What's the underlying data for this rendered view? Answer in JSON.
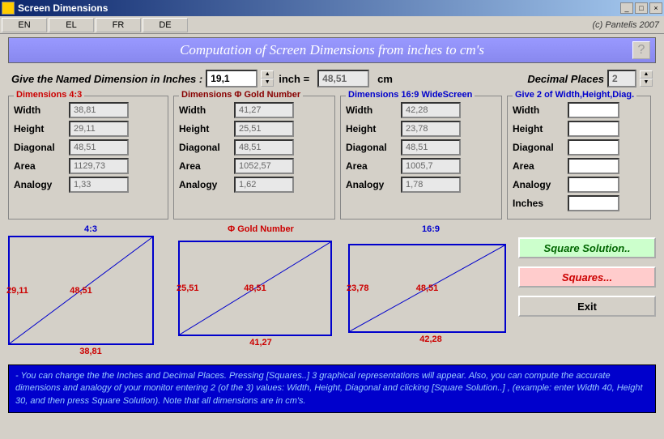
{
  "window": {
    "title": "Screen Dimensions"
  },
  "lang": {
    "en": "EN",
    "el": "EL",
    "fr": "FR",
    "de": "DE"
  },
  "copyright": "(c)  Pantelis 2007",
  "banner": "Computation of Screen Dimensions from inches to cm's",
  "help": "?",
  "input": {
    "label": "Give the Named Dimension in Inches :",
    "inches": "19,1",
    "unit": "inch =",
    "cm": "48,51",
    "cm_unit": "cm",
    "dp_label": "Decimal Places",
    "dp": "2"
  },
  "labels": {
    "width": "Width",
    "height": "Height",
    "diagonal": "Diagonal",
    "area": "Area",
    "analogy": "Analogy",
    "inches": "Inches"
  },
  "groups": {
    "r43": {
      "title": "Dimensions 4:3",
      "width": "38,81",
      "height": "29,11",
      "diagonal": "48,51",
      "area": "1129,73",
      "analogy": "1,33"
    },
    "phi": {
      "title": "Dimensions Φ Gold Number",
      "width": "41,27",
      "height": "25,51",
      "diagonal": "48,51",
      "area": "1052,57",
      "analogy": "1,62"
    },
    "r169": {
      "title": "Dimensions 16:9 WideScreen",
      "width": "42,28",
      "height": "23,78",
      "diagonal": "48,51",
      "area": "1005,7",
      "analogy": "1,78"
    },
    "give2": {
      "title": "Give 2 of Width,Height,Diag."
    }
  },
  "diagrams": {
    "r43": {
      "title": "4:3",
      "left": "29,11",
      "center": "48,51",
      "bottom": "38,81"
    },
    "phi": {
      "title": "Φ Gold Number",
      "left": "25,51",
      "center": "48,51",
      "bottom": "41,27"
    },
    "r169": {
      "title": "16:9",
      "left": "23,78",
      "center": "48,51",
      "bottom": "42,28"
    }
  },
  "buttons": {
    "sqsol": "Square Solution..",
    "squares": "Squares...",
    "exit": "Exit"
  },
  "info": "- You can change the the Inches and Decimal Places. Pressing  [Squares..] 3 graphical representations will appear. Also, you can compute the accurate dimensions and analogy of your monitor entering 2 (of the 3) values: Width, Height, Diagonal and clicking [Square Solution..] , (example: enter Width 40, Height 30, and then press Square Solution). Note that all dimensions are in cm's."
}
